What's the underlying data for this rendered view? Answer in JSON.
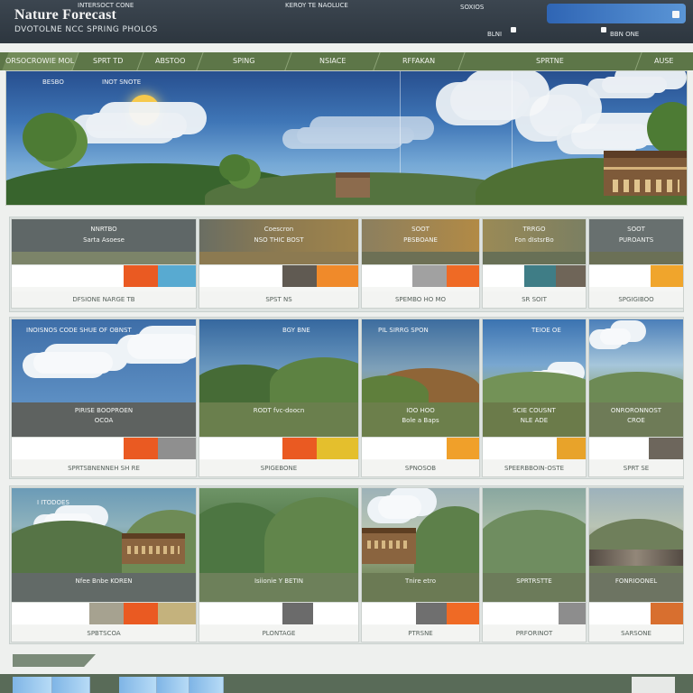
{
  "header": {
    "title": "Nature Forecast",
    "subtitle": "DVOTOLNE NCC SPRING PHOLOS",
    "mini_left": "INTERSOCT CONE",
    "mini_center": "KEROY TE NAOLUCE",
    "mini_right": "SOXIOS",
    "mini_right_2": "BLNI",
    "mini_right_3": "BBN ONE"
  },
  "nav": {
    "items": [
      {
        "label": "ORSOCROWIE MOL FOBORE"
      },
      {
        "label": "SPRT TD"
      },
      {
        "label": "ABSTOO"
      },
      {
        "label": "SPING"
      },
      {
        "label": "NSIACE"
      },
      {
        "label": "RFFAKAN"
      },
      {
        "label": "SPRTNE"
      },
      {
        "label": "AUSE"
      }
    ]
  },
  "hero": {
    "label_left": "BESBO",
    "label_mid": "INOT SNOTE"
  },
  "cards": {
    "row1": [
      {
        "head1": "NNRTBO",
        "head2": "Sarta Asoese",
        "footer": "DFSIONE NARGE TB",
        "swatches": [
          "#ffffff",
          "#ea5a22",
          "#58aad1"
        ]
      },
      {
        "head1": "Coescron",
        "head2": "NSO THIC BOST",
        "footer": "SPST NS",
        "swatches": [
          "#ffffff",
          "#605a52",
          "#f08a2a"
        ]
      },
      {
        "head1": "SOOT",
        "head2": "PBSBOANE",
        "footer": "SPEMBO HO MO",
        "swatches": [
          "#ffffff",
          "#a1a1a1",
          "#ef6a25"
        ]
      },
      {
        "head1": "TRRGO",
        "head2": "Fon dIstsrBo",
        "footer": "SR SOIT",
        "swatches": [
          "#ffffff",
          "#3f7d86",
          "#6f6558"
        ]
      },
      {
        "head1": "SOOT",
        "head2": "PUROANTS",
        "footer": "SPGIGIBOO",
        "swatches": [
          "#ffffff",
          "#f0a52c"
        ]
      }
    ],
    "row2": [
      {
        "image_title": "INOISNOS CODE SHUE OF OBNST",
        "label1": "PIRISE BOOPROEN",
        "label2": "OCOA",
        "footer": "SPRTSBNENNEH SH RE",
        "swatches": [
          "#ffffff",
          "#ea5a22",
          "#8f8f8f"
        ]
      },
      {
        "image_title": "BGY BNE",
        "label1": "RODT fvc-doocn",
        "label2": "",
        "footer": "SPIGEBONE",
        "swatches": [
          "#ffffff",
          "#ea5a22",
          "#e4bf2d"
        ]
      },
      {
        "image_title": "PIL SIRRG SPON",
        "label1": "IOO HOO",
        "label2": "Bole a Baps",
        "footer": "SPNOSOB",
        "swatches": [
          "#ffffff",
          "#f0a02a"
        ]
      },
      {
        "image_title": "TEIOE OE",
        "label1": "SCIE COUSNT",
        "label2": "NLE ADE",
        "footer": "SPEERBBOIN-OSTE",
        "swatches": [
          "#ffffff",
          "#e8a32a"
        ]
      },
      {
        "image_title": "",
        "label1": "ONRORONNOST",
        "label2": "CROE",
        "footer": "SPRT SE",
        "swatches": [
          "#ffffff",
          "#6d665c"
        ]
      }
    ],
    "row3": [
      {
        "image_title": "I ITODOES",
        "label1": "Nfee Bnbe KOREN",
        "footer": "SPBTSCOA",
        "swatches": [
          "#ffffff",
          "#a6a290",
          "#ea5a22",
          "#c4b27d"
        ]
      },
      {
        "image_title": "",
        "label1": "Isiionie Y BETIN",
        "footer": "PLONTAGE",
        "swatches": [
          "#ffffff",
          "#6b6b6b",
          "#ffffff"
        ]
      },
      {
        "image_title": "",
        "label1": "Tnire etro",
        "footer": "PTRSNE",
        "swatches": [
          "#ffffff",
          "#6f6f6f",
          "#ef6a25"
        ]
      },
      {
        "image_title": "",
        "label1": "SPRTRSTTE",
        "footer": "PRFORINOT",
        "swatches": [
          "#ffffff",
          "#8d8d8d"
        ]
      },
      {
        "image_title": "",
        "label1": "FONRIOONEL",
        "footer": "SARSONE",
        "swatches": [
          "#ffffff",
          "#d86f2f"
        ]
      }
    ]
  },
  "bottom": {
    "right_box": ""
  }
}
